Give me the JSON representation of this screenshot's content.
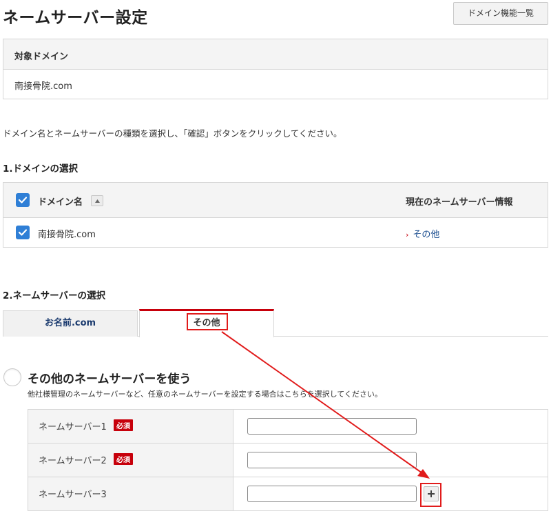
{
  "header": {
    "title": "ネームサーバー設定",
    "domain_functions_button": "ドメイン機能一覧"
  },
  "target_domain": {
    "heading": "対象ドメイン",
    "value": "南接骨院.com"
  },
  "instruction": "ドメイン名とネームサーバーの種類を選択し、「確認」ボタンをクリックしてください。",
  "step1": {
    "title": "1.ドメインの選択",
    "columns": {
      "domain_name": "ドメイン名",
      "current_ns": "現在のネームサーバー情報"
    },
    "rows": [
      {
        "domain": "南接骨院.com",
        "ns_info": "その他",
        "checked": true
      }
    ],
    "select_all_checked": true
  },
  "step2": {
    "title": "2.ネームサーバーの選択",
    "tabs": [
      {
        "label": "お名前.com",
        "active": false
      },
      {
        "label": "その他",
        "active": true
      }
    ],
    "option": {
      "title": "その他のネームサーバーを使う",
      "description": "他社様管理のネームサーバーなど、任意のネームサーバーを設定する場合はこちらを選択してください。",
      "selected": false
    },
    "nameservers": [
      {
        "label": "ネームサーバー1",
        "required": true,
        "value": ""
      },
      {
        "label": "ネームサーバー2",
        "required": true,
        "value": ""
      },
      {
        "label": "ネームサーバー3",
        "required": false,
        "value": ""
      }
    ],
    "required_badge": "必須"
  },
  "colors": {
    "accent_red": "#c7000b",
    "checkbox_blue": "#2f7fd6",
    "annotation_red": "#e11b1b",
    "link_blue": "#1a4d8f"
  }
}
